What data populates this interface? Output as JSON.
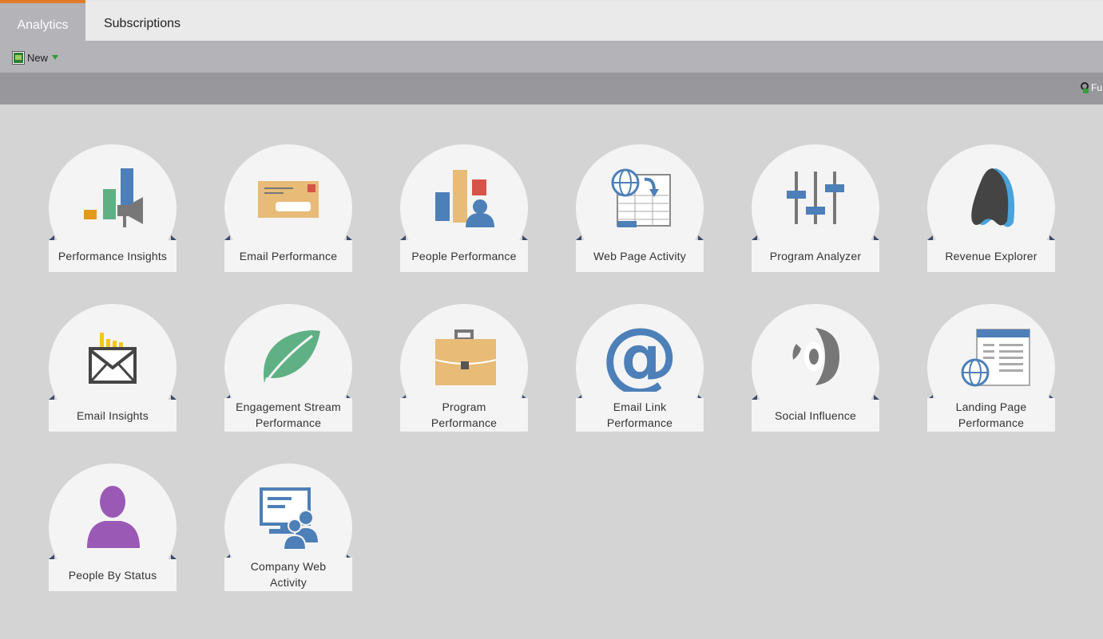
{
  "tabs": [
    {
      "label": "Analytics",
      "active": true
    },
    {
      "label": "Subscriptions",
      "active": false
    }
  ],
  "toolbar": {
    "new_label": "New"
  },
  "subbar": {
    "right_label": "Fu"
  },
  "tiles": [
    {
      "label": "Performance Insights",
      "icon": "performance-insights-icon"
    },
    {
      "label": "Email Performance",
      "icon": "email-envelope-icon"
    },
    {
      "label": "People Performance",
      "icon": "people-performance-icon"
    },
    {
      "label": "Web Page Activity",
      "icon": "web-page-activity-icon"
    },
    {
      "label": "Program Analyzer",
      "icon": "sliders-icon"
    },
    {
      "label": "Revenue Explorer",
      "icon": "revenue-explorer-icon"
    },
    {
      "label": "Email Insights",
      "icon": "email-insights-icon"
    },
    {
      "label": "Engagement Stream Performance",
      "icon": "leaf-icon"
    },
    {
      "label": "Program Performance",
      "icon": "briefcase-icon"
    },
    {
      "label": "Email Link Performance",
      "icon": "at-sign-icon"
    },
    {
      "label": "Social Influence",
      "icon": "social-influence-icon"
    },
    {
      "label": "Landing Page Performance",
      "icon": "landing-page-icon"
    },
    {
      "label": "People By Status",
      "icon": "person-silhouette-icon"
    },
    {
      "label": "Company Web Activity",
      "icon": "company-web-activity-icon"
    }
  ],
  "colors": {
    "accent": "#e07b2a",
    "blue": "#4d7fb8",
    "orange": "#e8bb77",
    "green": "#5fb085",
    "purple": "#9b59b6",
    "gray": "#777777"
  }
}
